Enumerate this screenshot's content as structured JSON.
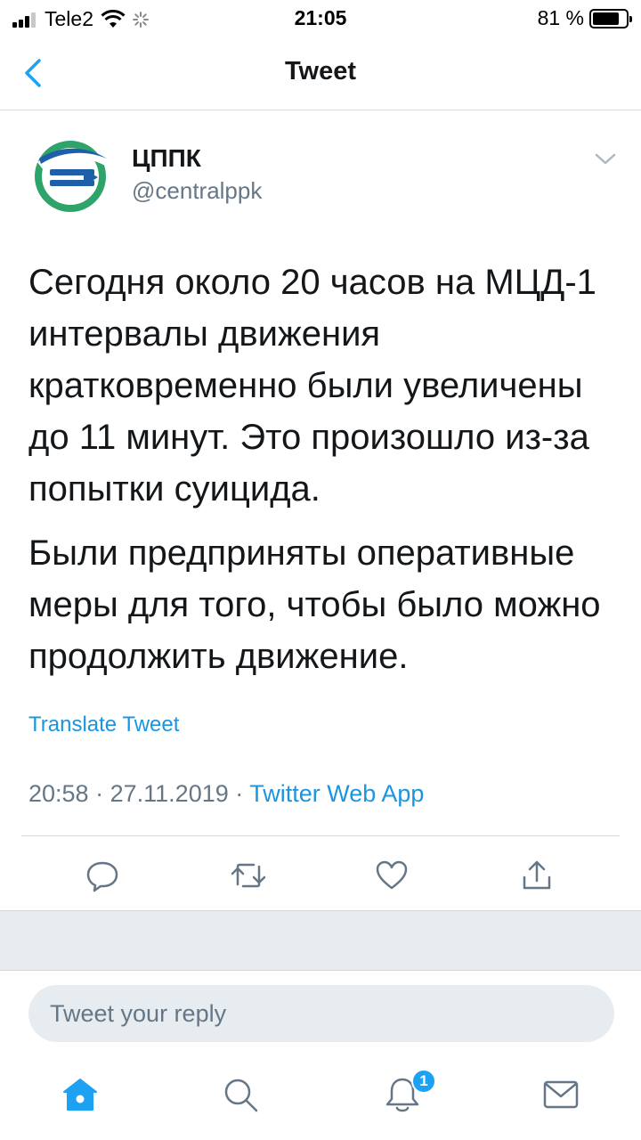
{
  "status_bar": {
    "carrier": "Tele2",
    "time": "21:05",
    "battery_percent": "81 %",
    "battery_level": 0.81
  },
  "nav": {
    "title": "Tweet",
    "back_icon": "chevron-left-icon"
  },
  "tweet": {
    "author_name": "ЦППК",
    "author_handle": "@centralppk",
    "paragraph_1": "Сегодня около 20 часов на МЦД-1 интервалы движения кратковременно были увеличены до 11 минут. Это произошло из-за попытки суицида.",
    "paragraph_2": "Были предприняты оперативные меры для того, чтобы было можно продолжить движение.",
    "translate_label": "Translate Tweet",
    "time": "20:58",
    "date": "27.11.2019",
    "separator": "·",
    "source": "Twitter Web App"
  },
  "actions": {
    "reply_icon": "reply-icon",
    "retweet_icon": "retweet-icon",
    "like_icon": "heart-icon",
    "share_icon": "share-icon"
  },
  "reply_box": {
    "placeholder": "Tweet your reply"
  },
  "tabbar": {
    "notifications_badge": "1"
  },
  "colors": {
    "accent": "#1da1f2",
    "link": "#1b95e0",
    "secondary_text": "#657786",
    "logo_green": "#2ea36a",
    "logo_blue": "#1d5fa8"
  }
}
